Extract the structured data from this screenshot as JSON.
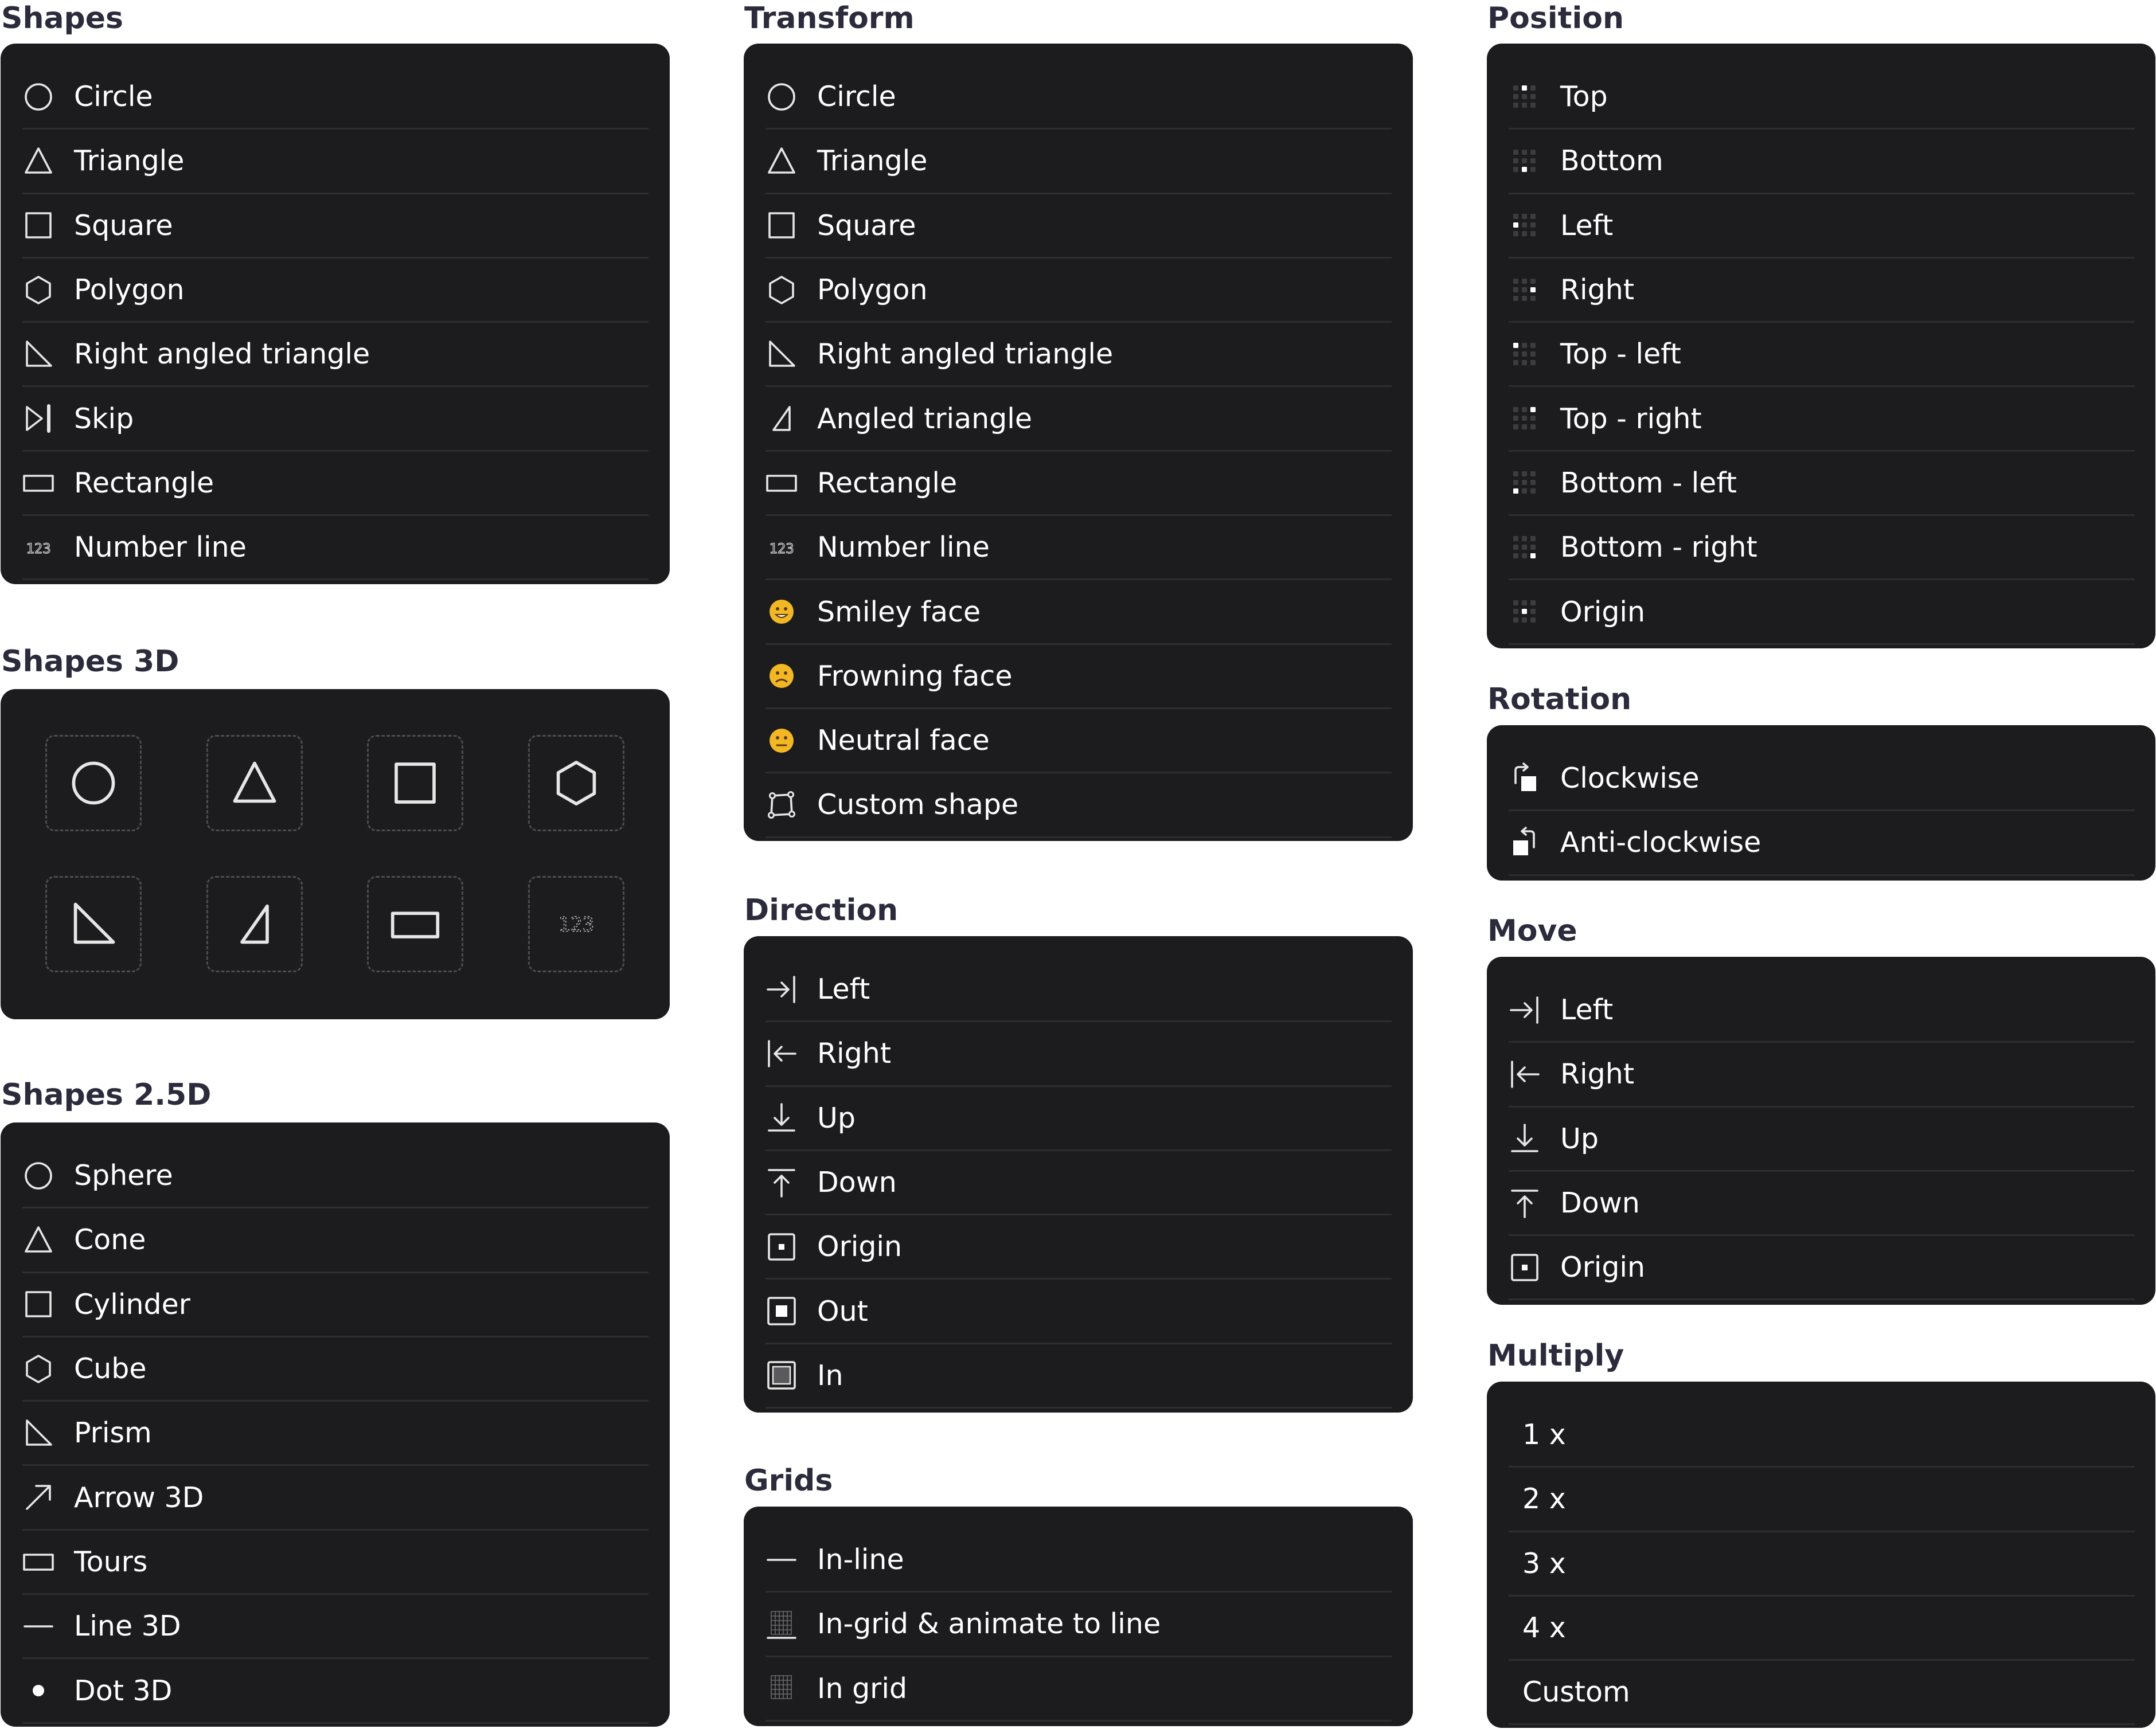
{
  "sections": {
    "shapes": {
      "title": "Shapes",
      "items": [
        {
          "label": "Circle",
          "icon": "circle-icon"
        },
        {
          "label": "Triangle",
          "icon": "triangle-icon"
        },
        {
          "label": "Square",
          "icon": "square-icon"
        },
        {
          "label": "Polygon",
          "icon": "hexagon-icon"
        },
        {
          "label": "Right angled triangle",
          "icon": "right-triangle-icon"
        },
        {
          "label": "Skip",
          "icon": "skip-icon"
        },
        {
          "label": "Rectangle",
          "icon": "rectangle-icon"
        },
        {
          "label": "Number line",
          "icon": "number-line-icon"
        }
      ]
    },
    "shapes3d": {
      "title": "Shapes 3D",
      "tiles": [
        {
          "icon": "circle-icon"
        },
        {
          "icon": "triangle-icon"
        },
        {
          "icon": "square-icon"
        },
        {
          "icon": "hexagon-icon"
        },
        {
          "icon": "right-triangle-icon"
        },
        {
          "icon": "angled-triangle-icon"
        },
        {
          "icon": "rectangle-icon"
        },
        {
          "icon": "number-line-icon",
          "text": "123"
        }
      ]
    },
    "shapes25d": {
      "title": "Shapes 2.5D",
      "items": [
        {
          "label": "Sphere",
          "icon": "circle-icon"
        },
        {
          "label": "Cone",
          "icon": "triangle-icon"
        },
        {
          "label": "Cylinder",
          "icon": "square-icon"
        },
        {
          "label": "Cube",
          "icon": "hexagon-icon"
        },
        {
          "label": "Prism",
          "icon": "right-triangle-icon"
        },
        {
          "label": "Arrow 3D",
          "icon": "diagonal-arrow-icon"
        },
        {
          "label": "Tours",
          "icon": "rectangle-icon"
        },
        {
          "label": "Line 3D",
          "icon": "line-icon"
        },
        {
          "label": "Dot 3D",
          "icon": "dot-icon"
        }
      ]
    },
    "transform": {
      "title": "Transform",
      "items": [
        {
          "label": "Circle",
          "icon": "circle-icon"
        },
        {
          "label": "Triangle",
          "icon": "triangle-icon"
        },
        {
          "label": "Square",
          "icon": "square-icon"
        },
        {
          "label": "Polygon",
          "icon": "hexagon-icon"
        },
        {
          "label": "Right angled triangle",
          "icon": "right-triangle-icon"
        },
        {
          "label": "Angled triangle",
          "icon": "angled-triangle-icon"
        },
        {
          "label": "Rectangle",
          "icon": "rectangle-icon"
        },
        {
          "label": "Number line",
          "icon": "number-line-icon"
        },
        {
          "label": "Smiley face",
          "icon": "smiley-face-icon"
        },
        {
          "label": "Frowning face",
          "icon": "frowning-face-icon"
        },
        {
          "label": "Neutral face",
          "icon": "neutral-face-icon"
        },
        {
          "label": "Custom shape",
          "icon": "custom-shape-icon"
        }
      ]
    },
    "direction": {
      "title": "Direction",
      "items": [
        {
          "label": "Left",
          "icon": "arrow-to-right-bar-icon"
        },
        {
          "label": "Right",
          "icon": "arrow-from-left-bar-icon"
        },
        {
          "label": "Up",
          "icon": "arrow-down-to-line-icon"
        },
        {
          "label": "Down",
          "icon": "arrow-up-from-line-icon"
        },
        {
          "label": "Origin",
          "icon": "origin-box-icon"
        },
        {
          "label": "Out",
          "icon": "out-box-icon"
        },
        {
          "label": "In",
          "icon": "in-box-icon"
        }
      ]
    },
    "grids": {
      "title": "Grids",
      "items": [
        {
          "label": "In-line",
          "icon": "line-icon"
        },
        {
          "label": "In-grid & animate to line",
          "icon": "grid-to-line-icon"
        },
        {
          "label": "In grid",
          "icon": "grid-icon"
        }
      ]
    },
    "position": {
      "title": "Position",
      "items": [
        {
          "label": "Top",
          "icon": "position-grid-icon"
        },
        {
          "label": "Bottom",
          "icon": "position-grid-icon"
        },
        {
          "label": "Left",
          "icon": "position-grid-icon"
        },
        {
          "label": "Right",
          "icon": "position-grid-icon"
        },
        {
          "label": "Top - left",
          "icon": "position-grid-icon"
        },
        {
          "label": "Top - right",
          "icon": "position-grid-icon"
        },
        {
          "label": "Bottom - left",
          "icon": "position-grid-icon"
        },
        {
          "label": "Bottom - right",
          "icon": "position-grid-icon"
        },
        {
          "label": "Origin",
          "icon": "position-grid-icon"
        }
      ]
    },
    "rotation": {
      "title": "Rotation",
      "items": [
        {
          "label": "Clockwise",
          "icon": "rotate-clockwise-icon"
        },
        {
          "label": "Anti-clockwise",
          "icon": "rotate-anticlockwise-icon"
        }
      ]
    },
    "move": {
      "title": "Move",
      "items": [
        {
          "label": "Left",
          "icon": "arrow-to-right-bar-icon"
        },
        {
          "label": "Right",
          "icon": "arrow-from-left-bar-icon"
        },
        {
          "label": "Up",
          "icon": "arrow-down-to-line-icon"
        },
        {
          "label": "Down",
          "icon": "arrow-up-from-line-icon"
        },
        {
          "label": "Origin",
          "icon": "origin-box-icon"
        }
      ]
    },
    "multiply": {
      "title": "Multiply",
      "items": [
        {
          "label": "1 x"
        },
        {
          "label": "2 x"
        },
        {
          "label": "3 x"
        },
        {
          "label": "4 x"
        },
        {
          "label": "Custom"
        }
      ]
    }
  },
  "colors": {
    "panel": "#1c1c1e",
    "title": "#2c2b3c",
    "text": "#ffffff",
    "divider": "#2e2e31",
    "icon": "#e6e6e6",
    "emoji": "#f2b724"
  }
}
